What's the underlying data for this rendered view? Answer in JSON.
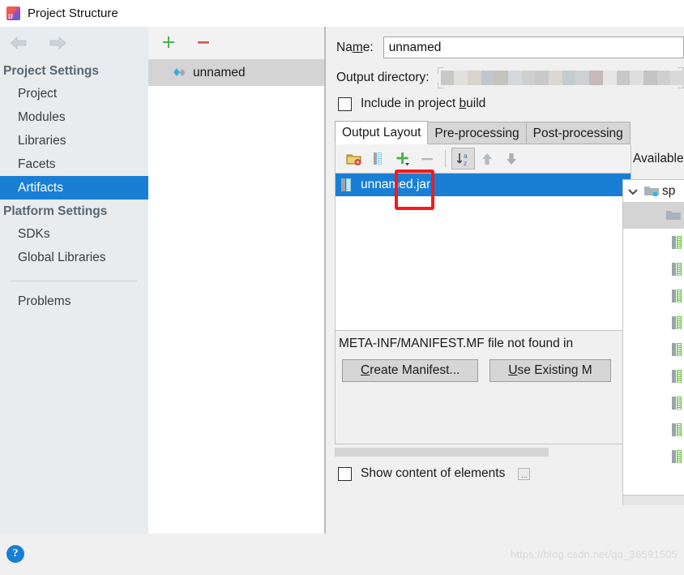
{
  "window": {
    "title": "Project Structure",
    "app_icon": "intellij-idea-icon"
  },
  "sidebar": {
    "back_icon": "arrow-left-icon",
    "forward_icon": "arrow-right-icon",
    "groups": [
      {
        "label": "Project Settings",
        "items": [
          {
            "label": "Project",
            "selected": false
          },
          {
            "label": "Modules",
            "selected": false
          },
          {
            "label": "Libraries",
            "selected": false
          },
          {
            "label": "Facets",
            "selected": false
          },
          {
            "label": "Artifacts",
            "selected": true
          }
        ]
      },
      {
        "label": "Platform Settings",
        "items": [
          {
            "label": "SDKs",
            "selected": false
          },
          {
            "label": "Global Libraries",
            "selected": false
          }
        ]
      }
    ],
    "problems_label": "Problems"
  },
  "artifact_list": {
    "add_icon": "plus-icon",
    "remove_icon": "minus-icon",
    "items": [
      {
        "label": "unnamed",
        "icon": "artifact-diamond-icon",
        "selected": true
      }
    ]
  },
  "detail": {
    "name_label": "Name:",
    "name_label_pre": "Na",
    "name_label_mnemonic": "m",
    "name_label_post": "e:",
    "name_value": "unnamed",
    "output_dir_label": "Output directory:",
    "output_dir_value": "",
    "include_in_build": {
      "label_pre": "Include in project ",
      "label_mnemonic": "b",
      "label_post": "uild",
      "checked": false
    },
    "tabs": [
      {
        "label": "Output Layout",
        "active": true
      },
      {
        "label": "Pre-processing",
        "active": false
      },
      {
        "label": "Post-processing",
        "active": false
      }
    ],
    "toolbar": [
      {
        "name": "add-directory-icon",
        "label": ""
      },
      {
        "name": "add-archive-icon",
        "label": ""
      },
      {
        "name": "add-copy-icon",
        "label": "",
        "highlighted": true
      },
      {
        "name": "remove-icon",
        "label": ""
      },
      {
        "name": "sort-alphabetically-icon",
        "label": "",
        "pressed": true
      },
      {
        "name": "move-up-icon",
        "label": ""
      },
      {
        "name": "move-down-icon",
        "label": ""
      }
    ],
    "available_elements_label": "Available",
    "tree_rows": [
      {
        "label": "unnamed.jar",
        "icon": "jar-icon",
        "selected": true
      }
    ],
    "manifest_message": "META-INF/MANIFEST.MF file not found in",
    "create_manifest_pre": "",
    "create_manifest_mnemonic": "C",
    "create_manifest_post": "reate Manifest...",
    "use_existing_mnemonic": "U",
    "use_existing_post": "se Existing M",
    "show_content_label": "Show content of elements",
    "show_content_checked": false,
    "ellipsis_label": "..."
  },
  "available_panel": {
    "root_label": "sp",
    "chevron_icon": "chevron-down-icon",
    "folder_icon": "folder-icon",
    "rows": [
      {
        "icon": "",
        "grey": true
      },
      {
        "icon": "jar-icon",
        "grey": false
      },
      {
        "icon": "jar-icon",
        "grey": false
      },
      {
        "icon": "jar-icon",
        "grey": false
      },
      {
        "icon": "jar-icon",
        "grey": false
      },
      {
        "icon": "jar-icon",
        "grey": false
      },
      {
        "icon": "jar-icon",
        "grey": false
      },
      {
        "icon": "jar-icon",
        "grey": false
      },
      {
        "icon": "jar-icon",
        "grey": false
      },
      {
        "icon": "jar-icon",
        "grey": false
      },
      {
        "icon": "jar-icon",
        "grey": false
      }
    ]
  },
  "footer": {
    "help_label": "?",
    "watermark": "https://blog.csdn.net/qq_36591505"
  },
  "colors": {
    "selection_blue": "#1a7fd4",
    "annotation_red": "#f61a1a",
    "sidebar_bg": "#e8ecef",
    "panel_bg": "#f0f0f0"
  }
}
